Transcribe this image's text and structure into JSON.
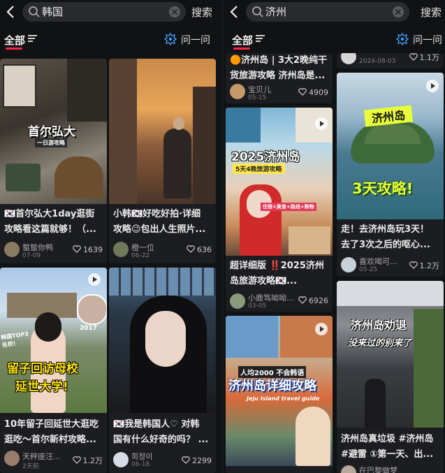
{
  "left": {
    "query": "韩国",
    "search_button": "搜索",
    "tab_all": "全部",
    "ask": "问一问",
    "cards": [
      {
        "title": "🇰🇷首尔弘大1day逛街\n攻略看这篇就够！（...",
        "author": "蜇蜇你鸭",
        "date": "07-09",
        "likes": "1639",
        "overlay": "首尔弘大",
        "overlay2": "一日游攻略"
      },
      {
        "title": "小韩🇰🇷好吃好拍·详细\n攻略😉包出人生照片...",
        "author": "橙一位",
        "date": "06-22",
        "likes": "636"
      },
      {
        "title": "10年留子回延世大逛吃\n逛吃～首尔新村攻略...",
        "author": "天秤座汪...",
        "date": "2天前",
        "likes": "1.2万",
        "overlay": "留子回访母校",
        "overlay2": "延世大学!",
        "tag": "韩国TOP3名校!",
        "year": "2017"
      },
      {
        "title": "🇰🇷我是韩国人♡ 对韩\n国有什么好奇的吗？ ...",
        "author": "희정이",
        "date": "06-18",
        "likes": "2299"
      }
    ]
  },
  "right": {
    "query": "济州",
    "search_button": "搜索",
    "tab_all": "全部",
    "ask": "问一问",
    "cards": [
      {
        "title": "🟠济州岛 | 3大2晚纯干\n货旅游攻略 济州岛是...",
        "author": "宝贝儿",
        "date": "05-15",
        "likes": "4909"
      },
      {
        "title": "",
        "author": "",
        "date": "2024-08-03",
        "likes": "1.1万"
      },
      {
        "title": "超详细版 ‼️2025济州\n岛旅游攻略🇰🇷...",
        "author": "小鹿笃呦呦...",
        "date": "03-05",
        "likes": "6926",
        "overlay": "2025济州岛",
        "overlay2": "5天4晚旅游攻略",
        "tag": "住宿+美食+路线+购物"
      },
      {
        "title": "走！去济州岛玩3天！\n去了3次之后的呕心...",
        "author": "喜欢喝可...",
        "date": "05-25",
        "likes": "1.2万",
        "overlay": "济州岛",
        "overlay2": "3天攻略!"
      },
      {
        "title": "济州岛详细攻略",
        "author": "",
        "date": "",
        "likes": "",
        "overlay": "济州岛详细攻略",
        "overlay2": "人均2000 不会韩语",
        "tag": "Jeju Island travel guide"
      },
      {
        "title": "济州岛真垃圾 #济州岛\n#避雷 ①第一天、出...",
        "author": "在巴黎做梦",
        "date": "",
        "likes": "",
        "overlay": "济州岛劝退",
        "overlay2": "没来过的别来了"
      }
    ]
  }
}
